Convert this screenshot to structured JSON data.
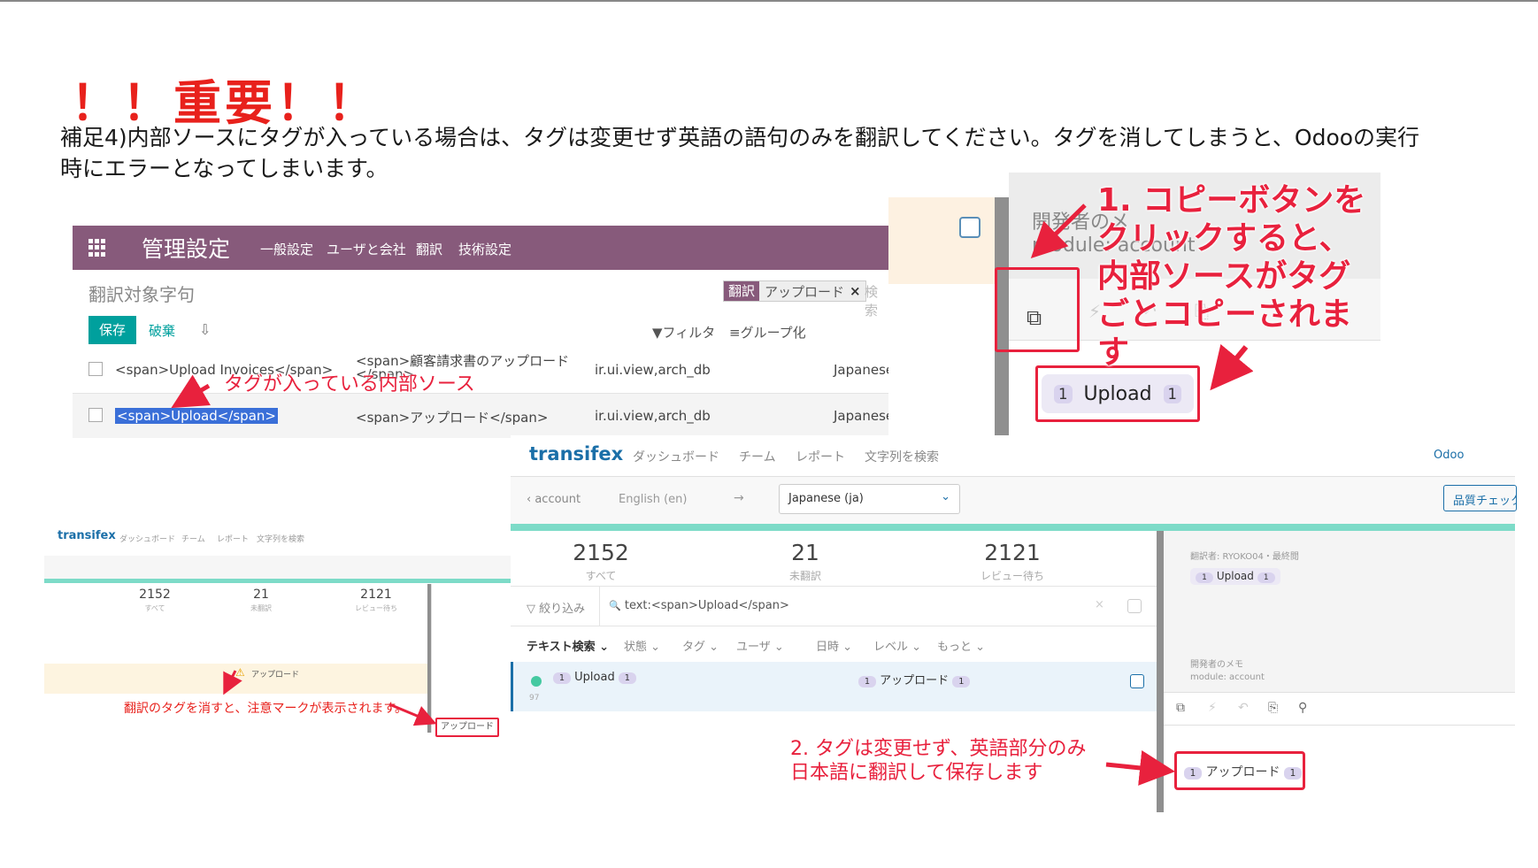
{
  "title": "！！重要！！",
  "description": "補足4)内部ソースにタグが入っている場合は、タグは変更せず英語の語句のみを翻訳してください。タグを消してしまうと、Odooの実行時にエラーとなってしまいます。",
  "odoo": {
    "brand": "管理設定",
    "nav": [
      "一般設定",
      "ユーザと会社",
      "翻訳",
      "技術設定"
    ],
    "breadcrumb": "翻訳対象字句",
    "facet_key": "翻訳",
    "facet_value": "アップロード",
    "facet_remove": "×",
    "search_placeholder": "検索",
    "save_label": "保存",
    "discard_label": "破棄",
    "download_icon": "⇩",
    "filter_label": "▼フィルタ",
    "group_label": "≡グループ化",
    "rows": [
      {
        "source": "<span>Upload Invoices</span>",
        "value": "<span>顧客請求書のアップロード",
        "value2": "</span>",
        "model": "ir.ui.view,arch_db",
        "lang": "Japanese"
      },
      {
        "source": "<span>Upload</span>",
        "value": "<span>アップロード</span>",
        "model": "ir.ui.view,arch_db",
        "lang": "Japanese"
      }
    ]
  },
  "zoom1": {
    "note_line1": "開発者のメ",
    "note_line2": "module: account",
    "copy_icon": "⧉",
    "tool_icons": [
      "⚡",
      "↶",
      "⎘"
    ],
    "pill_num": "1",
    "pill_text": "Upload"
  },
  "callouts": {
    "source_with_tags": "タグが入っている内部ソース",
    "step1": "1. コピーボタンをクリックすると、内部ソースがタグごとコピーされます",
    "step2_line1": "2. タグは変更せず、英語部分のみ",
    "step2_line2": "日本語に翻訳して保存します",
    "warning_note": "翻訳のタグを消すと、注意マークが表示されます。"
  },
  "transifex": {
    "brand": "transifex",
    "nav": [
      "ダッシュボード",
      "チーム",
      "レポート",
      "文字列を検索"
    ],
    "odoo_link": "Odoo",
    "crumb": "account",
    "from_lang": "English (en)",
    "arrow": "→",
    "to_lang": "Japanese (ja)",
    "chevron": "⌄",
    "qc_button": "品質チェック",
    "stats": [
      {
        "value": "2152",
        "label": "すべて"
      },
      {
        "value": "21",
        "label": "未翻訳"
      },
      {
        "value": "2121",
        "label": "レビュー待ち"
      }
    ],
    "search_label": "▽ 絞り込み",
    "search_icon": "🔍",
    "search_query": "text:<span>Upload</span>",
    "search_clear": "×",
    "filters": [
      "テキスト検索 ⌄",
      "状態 ⌄",
      "タグ ⌄",
      "ユーザ ⌄",
      "日時 ⌄",
      "レベル ⌄",
      "もっと ⌄"
    ],
    "row_source": "Upload",
    "row_translation": "アップロード",
    "row_meta": "97",
    "right_meta": "翻訳者: RYOKO04・最終閲",
    "right_pill": "Upload",
    "dev_note_line1": "開発者のメモ",
    "dev_note_line2": "module: account",
    "tools": [
      "⧉",
      "⚡",
      "↶",
      "⎘",
      "⚲"
    ],
    "final_translation": "アップロード"
  },
  "small": {
    "brand": "transifex",
    "nav": [
      "ダッシュボード",
      "チーム",
      "レポート",
      "文字列を検索"
    ],
    "stats": [
      {
        "value": "2152",
        "label": "すべて"
      },
      {
        "value": "21",
        "label": "未翻訳"
      },
      {
        "value": "2121",
        "label": "レビュー待ち"
      }
    ],
    "warn_icon": "⚠",
    "row_text": "アップロード",
    "box_text": "アップロード"
  },
  "colors": {
    "odoo_purple": "#875a7b",
    "odoo_teal": "#00a09d",
    "transifex_blue": "#1b6fa8",
    "progress_teal": "#7ddbc8",
    "annotation_red": "#e8213d"
  }
}
